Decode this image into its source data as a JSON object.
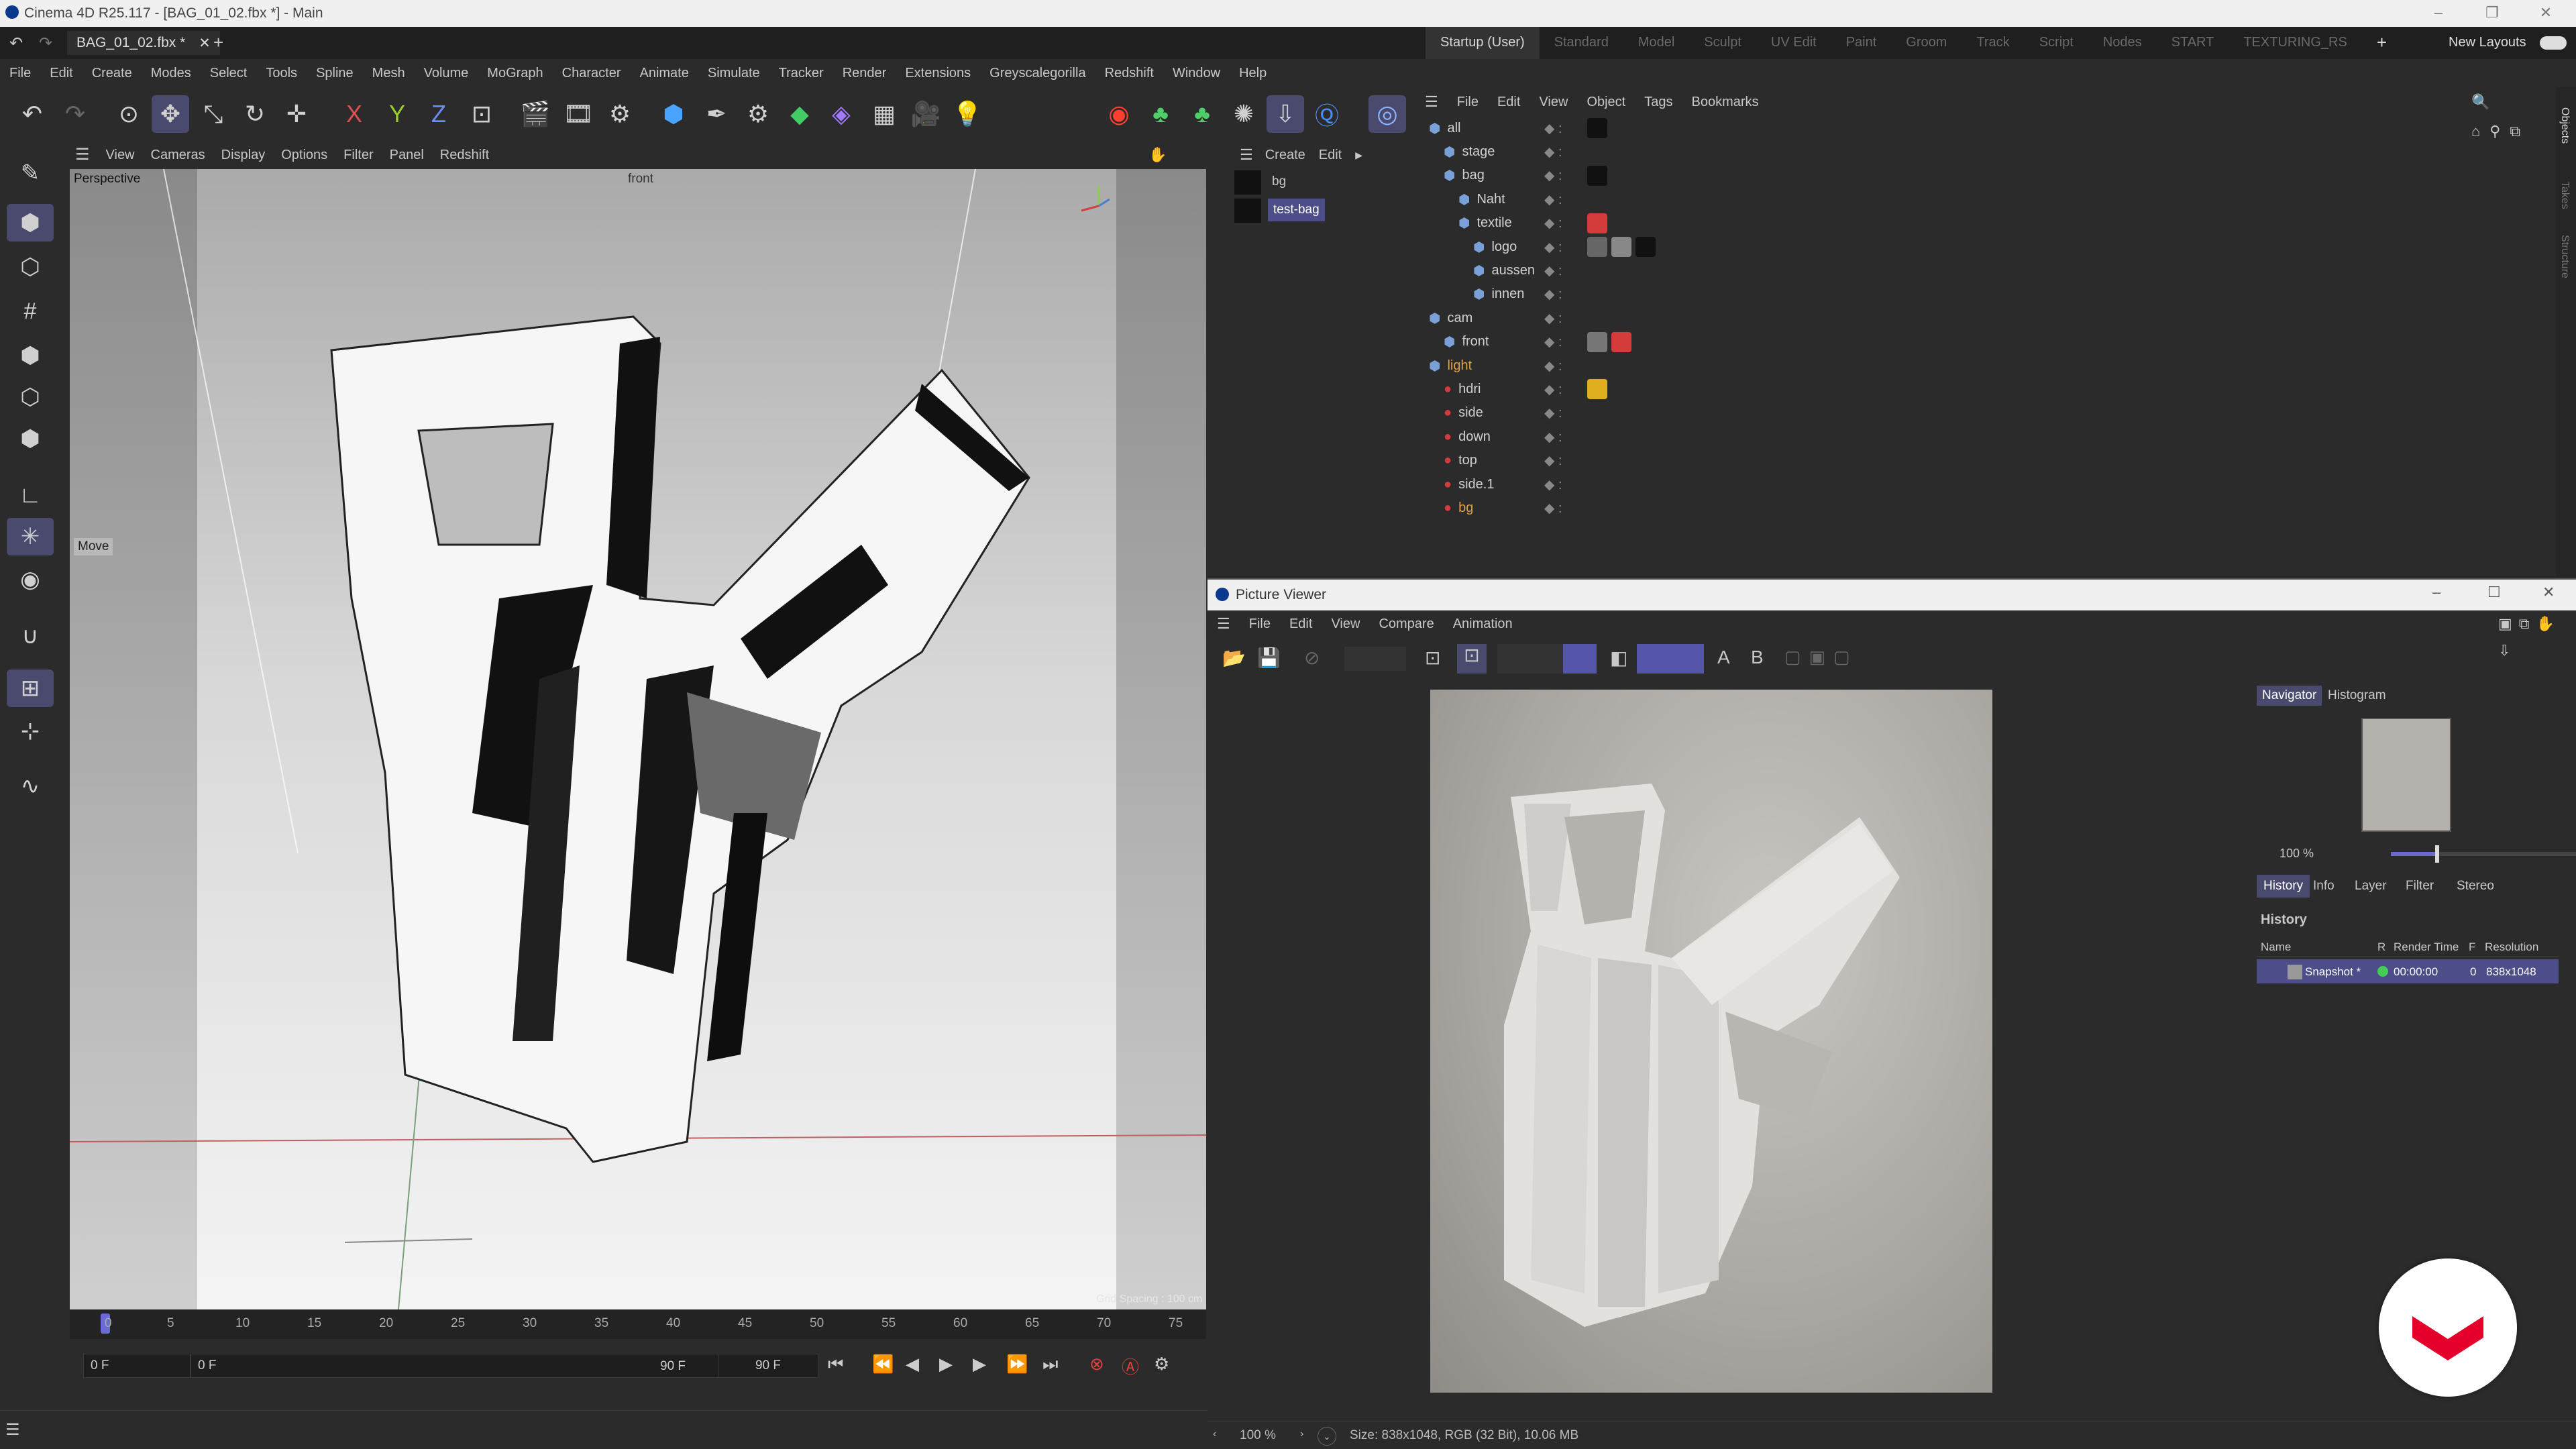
{
  "app": {
    "title": "Cinema 4D R25.117 - [BAG_01_02.fbx *] - Main",
    "doc_tab": "BAG_01_02.fbx *",
    "new_tab": "+"
  },
  "layouts": {
    "items": [
      "Startup (User)",
      "Standard",
      "Model",
      "Sculpt",
      "UV Edit",
      "Paint",
      "Groom",
      "Track",
      "Script",
      "Nodes",
      "START",
      "TEXTURING_RS"
    ],
    "add": "+",
    "new_layouts": "New Layouts"
  },
  "menu": [
    "File",
    "Edit",
    "Create",
    "Modes",
    "Select",
    "Tools",
    "Spline",
    "Mesh",
    "Volume",
    "MoGraph",
    "Character",
    "Animate",
    "Simulate",
    "Tracker",
    "Render",
    "Extensions",
    "Greyscalegorilla",
    "Redshift",
    "Window",
    "Help"
  ],
  "viewport": {
    "menu": [
      "View",
      "Cameras",
      "Display",
      "Options",
      "Filter",
      "Panel",
      "Redshift"
    ],
    "label": "Perspective",
    "camera": "front",
    "move_label": "Move",
    "watermark": "Grid Spacing : 100 cm"
  },
  "timeline": {
    "ticks": [
      "0",
      "5",
      "10",
      "15",
      "20",
      "25",
      "30",
      "35",
      "40",
      "45",
      "50",
      "55",
      "60",
      "65",
      "70",
      "75"
    ],
    "current_frame": "0 F",
    "start_frame": "0 F",
    "end_frame_a": "90 F",
    "end_frame_b": "90 F"
  },
  "layers": {
    "menu": [
      "Create",
      "Edit"
    ],
    "items": [
      "bg",
      "test-bag"
    ]
  },
  "objects": {
    "menu": [
      "File",
      "Edit",
      "View",
      "Object",
      "Tags",
      "Bookmarks"
    ],
    "tree": [
      {
        "name": "all",
        "depth": 0
      },
      {
        "name": "stage",
        "depth": 1
      },
      {
        "name": "bag",
        "depth": 1
      },
      {
        "name": "Naht",
        "depth": 2
      },
      {
        "name": "textile",
        "depth": 2
      },
      {
        "name": "logo",
        "depth": 3
      },
      {
        "name": "aussen",
        "depth": 3
      },
      {
        "name": "innen",
        "depth": 3
      },
      {
        "name": "cam",
        "depth": 0
      },
      {
        "name": "front",
        "depth": 1
      },
      {
        "name": "light",
        "depth": 0
      },
      {
        "name": "hdri",
        "depth": 1
      },
      {
        "name": "side",
        "depth": 1
      },
      {
        "name": "down",
        "depth": 1
      },
      {
        "name": "top",
        "depth": 1
      },
      {
        "name": "side.1",
        "depth": 1
      },
      {
        "name": "bg",
        "depth": 1
      }
    ],
    "side_tabs": [
      "Objects",
      "Takes",
      "Structure"
    ]
  },
  "picture_viewer": {
    "title": "Picture Viewer",
    "menu": [
      "File",
      "Edit",
      "View",
      "Compare",
      "Animation"
    ],
    "compare_a": "A",
    "compare_b": "B",
    "nav_tabs": [
      "Navigator",
      "Histogram"
    ],
    "zoom": "100 %",
    "tabs": [
      "History",
      "Info",
      "Layer",
      "Filter",
      "Stereo"
    ],
    "history_heading": "History",
    "columns": [
      "Name",
      "R",
      "Render Time",
      "F",
      "Resolution"
    ],
    "row": {
      "name": "Snapshot *",
      "time": "00:00:00",
      "frame": "0",
      "resolution": "838x1048"
    },
    "status_zoom": "100 %",
    "status_text": "Size: 838x1048, RGB (32 Bit), 10.06 MB"
  },
  "colors": {
    "accent": "#4a4a6e",
    "selection": "#4d4d8a",
    "render_bg": "#a9a6a2",
    "tag_red": "#d43c3c",
    "badge_red": "#e4002b"
  }
}
